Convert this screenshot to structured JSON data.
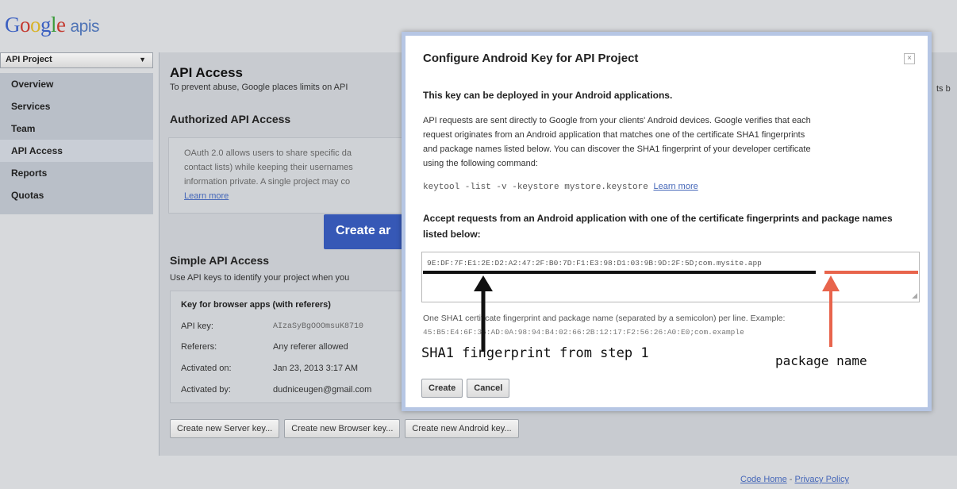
{
  "logo": {
    "g": "G",
    "o1": "o",
    "o2": "o",
    "g2": "g",
    "l": "l",
    "e": "e",
    "apis": "apis"
  },
  "sidebar": {
    "project_select": "API Project",
    "items": [
      {
        "label": "Overview"
      },
      {
        "label": "Services"
      },
      {
        "label": "Team"
      },
      {
        "label": "API Access",
        "active": true
      },
      {
        "label": "Reports"
      },
      {
        "label": "Quotas"
      }
    ]
  },
  "main": {
    "heading": "API Access",
    "prevent_text": "To prevent abuse, Google places limits on API",
    "right_cut_text": "ts b",
    "authorized_heading": "Authorized API Access",
    "oauth_lines": [
      "OAuth 2.0 allows users to share specific da",
      "contact lists) while keeping their usernames",
      "information private. A single project may co"
    ],
    "oauth_learn_more": "Learn more",
    "create_button": "Create ar",
    "simple_heading": "Simple API Access",
    "simple_text": "Use API keys to identify your project when you",
    "key_box": {
      "title": "Key for browser apps (with referers)",
      "rows": [
        {
          "label": "API key:",
          "value": "AIzaSyBgOOOmsuK8710"
        },
        {
          "label": "Referers:",
          "value": "Any referer allowed"
        },
        {
          "label": "Activated on:",
          "value": "Jan 23, 2013 3:17 AM"
        },
        {
          "label": "Activated by:",
          "value": "dudniceugen@gmail.com"
        }
      ]
    },
    "bottom_buttons": [
      "Create new Server key...",
      "Create new Browser key...",
      "Create new Android key..."
    ]
  },
  "footer": {
    "code_home": "Code Home",
    "separator": " - ",
    "privacy": "Privacy Policy"
  },
  "dialog": {
    "title": "Configure Android Key for API Project",
    "close_glyph": "×",
    "subtitle": "This key can be deployed in your Android applications.",
    "paragraph_lines": [
      "API requests are sent directly to Google from your clients' Android devices. Google verifies that each",
      "request originates from an Android application that matches one of the certificate SHA1 fingerprints",
      "and package names listed below. You can discover the SHA1 fingerprint of your developer certificate",
      "using the following command:"
    ],
    "command": "keytool -list -v -keystore mystore.keystore",
    "learn_more": "Learn more",
    "accept_text": "Accept requests from an Android application with one of the certificate fingerprints and package names listed below:",
    "textarea_value": "9E:DF:7F:E1:2E:D2:A2:47:2F:B0:7D:F1:E3:98:D1:03:9B:9D:2F:5D;com.mysite.app",
    "hint": "One SHA1 certificate fingerprint and package name (separated by a semicolon) per line. Example:",
    "example": "45:B5:E4:6F:36:AD:0A:98:94:B4:02:66:2B:12:17:F2:56:26:A0:E0;com.example",
    "buttons": {
      "create": "Create",
      "cancel": "Cancel"
    }
  },
  "annotations": {
    "sha1_label": "SHA1 fingerprint from step 1",
    "package_label": "package name",
    "sha1_color": "#111111",
    "package_color": "#e8644c"
  }
}
